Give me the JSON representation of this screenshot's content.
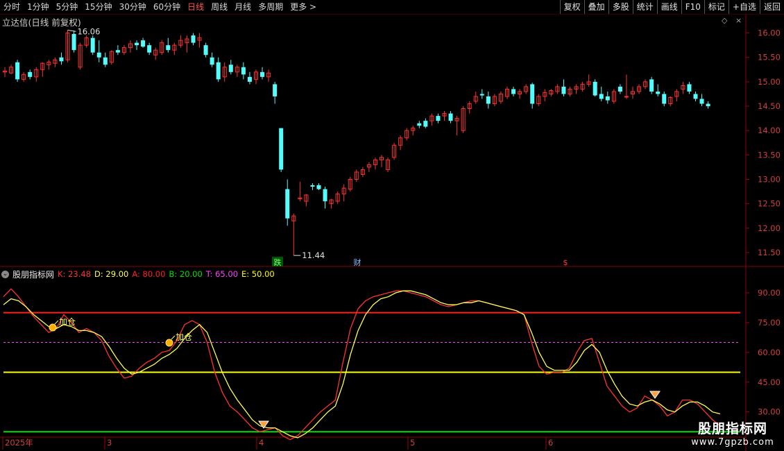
{
  "toolbar": {
    "periods": [
      "分时",
      "1分钟",
      "5分钟",
      "15分钟",
      "30分钟",
      "60分钟",
      "日线",
      "周线",
      "月线",
      "多周期",
      "更多 >"
    ],
    "active_index": 6,
    "right": [
      "复权",
      "叠加",
      "多股",
      "统计",
      "画线",
      "F10",
      "标记",
      "+自选",
      "返回"
    ]
  },
  "main": {
    "title": "立达信(日线 前复权)",
    "high_label": "16.06",
    "low_label": "11.44",
    "markers": [
      "跌",
      "财",
      "$"
    ]
  },
  "indicator": {
    "name": "股朋指标网",
    "K": "K: 23.48",
    "D": "D: 29.00",
    "A": "A: 80.00",
    "B": "B: 20.00",
    "T": "T: 65.00",
    "E": "E: 50.00",
    "signal": "加仓"
  },
  "dates": [
    "2025年",
    "3",
    "4",
    "5",
    "6"
  ],
  "logo": {
    "name": "股朋指标网",
    "url": "www.7gpzb.com"
  },
  "colors": {
    "up": "#ff3232",
    "down": "#54fcfc",
    "K": "#ff3232",
    "D": "#ffff54",
    "A": "#ff2020",
    "B": "#00e000",
    "T": "#ff40ff",
    "E": "#ffff00"
  },
  "chart_data": [
    {
      "type": "candlestick",
      "title": "立达信(日线 前复权)",
      "ylim": [
        11.3,
        16.25
      ],
      "yticks": [
        11.5,
        12.0,
        12.5,
        13.0,
        13.5,
        14.0,
        14.5,
        15.0,
        15.5,
        16.0
      ],
      "ohlc": [
        [
          15.2,
          15.3,
          15.1,
          15.22
        ],
        [
          15.18,
          15.35,
          15.15,
          15.3
        ],
        [
          15.4,
          15.45,
          15.0,
          15.05
        ],
        [
          15.05,
          15.2,
          15.0,
          15.15
        ],
        [
          15.2,
          15.25,
          15.05,
          15.1
        ],
        [
          15.1,
          15.3,
          15.0,
          15.25
        ],
        [
          15.25,
          15.4,
          15.1,
          15.38
        ],
        [
          15.35,
          15.45,
          15.25,
          15.4
        ],
        [
          15.38,
          15.5,
          15.3,
          15.45
        ],
        [
          15.5,
          15.6,
          15.35,
          15.42
        ],
        [
          15.45,
          16.06,
          15.4,
          16.0
        ],
        [
          15.98,
          16.05,
          15.6,
          15.65
        ],
        [
          15.3,
          15.8,
          15.25,
          15.75
        ],
        [
          15.75,
          15.95,
          15.7,
          15.9
        ],
        [
          15.9,
          15.95,
          15.55,
          15.6
        ],
        [
          15.6,
          15.85,
          15.4,
          15.5
        ],
        [
          15.5,
          15.6,
          15.3,
          15.35
        ],
        [
          15.4,
          15.65,
          15.35,
          15.62
        ],
        [
          15.65,
          15.75,
          15.55,
          15.6
        ],
        [
          15.6,
          15.75,
          15.55,
          15.7
        ],
        [
          15.7,
          15.85,
          15.6,
          15.78
        ],
        [
          15.8,
          15.85,
          15.65,
          15.75
        ],
        [
          15.85,
          15.9,
          15.7,
          15.72
        ],
        [
          15.75,
          15.8,
          15.55,
          15.6
        ],
        [
          15.55,
          15.7,
          15.45,
          15.65
        ],
        [
          15.6,
          15.85,
          15.55,
          15.8
        ],
        [
          15.75,
          15.9,
          15.6,
          15.65
        ],
        [
          15.65,
          15.8,
          15.55,
          15.75
        ],
        [
          15.75,
          15.95,
          15.7,
          15.85
        ],
        [
          15.8,
          15.95,
          15.6,
          15.88
        ],
        [
          15.95,
          16.0,
          15.75,
          15.8
        ],
        [
          15.85,
          16.0,
          15.7,
          15.9
        ],
        [
          15.75,
          15.8,
          15.5,
          15.55
        ],
        [
          15.5,
          15.6,
          15.3,
          15.35
        ],
        [
          15.4,
          15.5,
          15.0,
          15.05
        ],
        [
          15.1,
          15.4,
          15.0,
          15.3
        ],
        [
          15.35,
          15.45,
          15.15,
          15.2
        ],
        [
          15.2,
          15.35,
          15.1,
          15.3
        ],
        [
          15.3,
          15.4,
          15.05,
          15.15
        ],
        [
          15.1,
          15.2,
          14.95,
          15.0
        ],
        [
          15.05,
          15.25,
          14.95,
          15.2
        ],
        [
          15.2,
          15.3,
          15.05,
          15.1
        ],
        [
          15.1,
          15.25,
          15.0,
          15.18
        ],
        [
          14.95,
          15.0,
          14.55,
          14.7
        ],
        [
          14.05,
          14.05,
          13.15,
          13.2
        ],
        [
          12.8,
          13.0,
          12.05,
          12.2
        ],
        [
          12.15,
          12.3,
          11.44,
          12.25
        ],
        [
          12.6,
          12.95,
          12.55,
          12.62
        ],
        [
          12.55,
          12.7,
          12.45,
          12.68
        ],
        [
          12.88,
          12.92,
          12.78,
          12.85
        ],
        [
          12.88,
          12.92,
          12.78,
          12.8
        ],
        [
          12.8,
          12.85,
          12.4,
          12.55
        ],
        [
          12.5,
          12.6,
          12.4,
          12.58
        ],
        [
          12.55,
          12.75,
          12.5,
          12.7
        ],
        [
          12.7,
          12.9,
          12.55,
          12.82
        ],
        [
          12.8,
          13.05,
          12.75,
          13.0
        ],
        [
          13.0,
          13.2,
          12.95,
          13.15
        ],
        [
          13.1,
          13.25,
          13.05,
          13.2
        ],
        [
          13.25,
          13.35,
          13.15,
          13.3
        ],
        [
          13.3,
          13.45,
          13.2,
          13.4
        ],
        [
          13.4,
          13.5,
          13.25,
          13.45
        ],
        [
          13.2,
          13.45,
          13.15,
          13.4
        ],
        [
          13.45,
          13.75,
          13.4,
          13.7
        ],
        [
          13.7,
          13.9,
          13.6,
          13.85
        ],
        [
          13.85,
          14.05,
          13.8,
          14.0
        ],
        [
          14.0,
          14.1,
          13.9,
          14.05
        ],
        [
          14.15,
          14.2,
          14.05,
          14.1
        ],
        [
          14.2,
          14.25,
          14.05,
          14.08
        ],
        [
          14.2,
          14.35,
          14.1,
          14.3
        ],
        [
          14.3,
          14.35,
          14.15,
          14.2
        ],
        [
          14.3,
          14.4,
          14.2,
          14.35
        ],
        [
          14.35,
          14.4,
          14.15,
          14.2
        ],
        [
          14.2,
          14.3,
          13.9,
          14.25
        ],
        [
          14.0,
          14.5,
          13.95,
          14.45
        ],
        [
          14.45,
          14.6,
          14.35,
          14.55
        ],
        [
          14.6,
          14.8,
          14.55,
          14.7
        ],
        [
          14.75,
          14.85,
          14.65,
          14.72
        ],
        [
          14.7,
          14.8,
          14.45,
          14.55
        ],
        [
          14.55,
          14.75,
          14.5,
          14.7
        ],
        [
          14.6,
          14.8,
          14.55,
          14.75
        ],
        [
          14.7,
          14.9,
          14.65,
          14.85
        ],
        [
          14.85,
          14.9,
          14.7,
          14.75
        ],
        [
          14.75,
          14.85,
          14.65,
          14.8
        ],
        [
          14.8,
          14.95,
          14.75,
          14.9
        ],
        [
          14.95,
          14.98,
          14.45,
          14.55
        ],
        [
          14.55,
          14.75,
          14.5,
          14.7
        ],
        [
          14.7,
          14.85,
          14.6,
          14.78
        ],
        [
          14.75,
          14.85,
          14.7,
          14.82
        ],
        [
          14.8,
          14.95,
          14.75,
          14.9
        ],
        [
          14.9,
          15.05,
          14.7,
          14.75
        ],
        [
          14.75,
          14.9,
          14.7,
          14.85
        ],
        [
          14.85,
          14.95,
          14.75,
          14.9
        ],
        [
          14.85,
          15.0,
          14.8,
          14.95
        ],
        [
          14.95,
          15.15,
          14.9,
          15.0
        ],
        [
          15.0,
          15.05,
          14.7,
          14.72
        ],
        [
          14.75,
          14.9,
          14.6,
          14.65
        ],
        [
          14.7,
          14.8,
          14.55,
          14.62
        ],
        [
          14.6,
          14.85,
          14.55,
          14.8
        ],
        [
          14.9,
          14.95,
          14.75,
          14.8
        ],
        [
          14.7,
          15.15,
          14.65,
          14.7
        ],
        [
          14.75,
          14.9,
          14.65,
          14.8
        ],
        [
          14.8,
          14.95,
          14.75,
          14.9
        ],
        [
          14.9,
          15.05,
          14.85,
          15.0
        ],
        [
          15.05,
          15.1,
          14.75,
          14.8
        ],
        [
          14.8,
          14.95,
          14.7,
          14.75
        ],
        [
          14.75,
          14.8,
          14.5,
          14.55
        ],
        [
          14.55,
          14.7,
          14.5,
          14.68
        ],
        [
          14.7,
          14.85,
          14.6,
          14.8
        ],
        [
          14.85,
          15.0,
          14.75,
          14.92
        ],
        [
          14.95,
          15.0,
          14.75,
          14.8
        ],
        [
          14.75,
          14.8,
          14.6,
          14.65
        ],
        [
          14.65,
          14.75,
          14.5,
          14.55
        ],
        [
          14.55,
          14.6,
          14.45,
          14.5
        ]
      ]
    },
    {
      "type": "line",
      "title": "股朋指标网",
      "ylim": [
        18,
        97
      ],
      "yticks": [
        30,
        45,
        60,
        75,
        90
      ],
      "hlines": {
        "A": 80,
        "B": 20,
        "T": 65,
        "E": 50
      },
      "series": [
        {
          "name": "K",
          "values": [
            88,
            92,
            88,
            83,
            78,
            74,
            70,
            72,
            79,
            75,
            70,
            72,
            70,
            66,
            58,
            52,
            47,
            48,
            52,
            55,
            57,
            60,
            61,
            66,
            74,
            76,
            74,
            65,
            50,
            40,
            33,
            30,
            26,
            22,
            20,
            21,
            22,
            18,
            16,
            18,
            22,
            26,
            30,
            33,
            36,
            55,
            72,
            82,
            86,
            88,
            89,
            90,
            91,
            91,
            90,
            89,
            88,
            86,
            84,
            83,
            84,
            85,
            86,
            86,
            85,
            84,
            83,
            82,
            81,
            79,
            65,
            53,
            49,
            50,
            50,
            52,
            60,
            66,
            67,
            55,
            43,
            38,
            33,
            30,
            32,
            38,
            36,
            33,
            28,
            30,
            36,
            36,
            34,
            30,
            26,
            23
          ]
        },
        {
          "name": "D",
          "values": [
            84,
            87,
            86,
            83,
            79,
            76,
            73,
            72,
            74,
            73,
            71,
            71,
            70,
            68,
            63,
            57,
            52,
            49,
            50,
            52,
            54,
            57,
            59,
            62,
            67,
            71,
            74,
            70,
            60,
            50,
            42,
            36,
            31,
            26,
            23,
            22,
            22,
            20,
            18,
            17,
            19,
            22,
            26,
            30,
            33,
            44,
            59,
            71,
            79,
            84,
            87,
            88,
            90,
            91,
            91,
            90,
            89,
            87,
            85,
            84,
            84,
            85,
            85,
            86,
            85,
            84,
            83,
            82,
            81,
            79,
            70,
            60,
            53,
            51,
            51,
            51,
            55,
            61,
            64,
            60,
            51,
            44,
            38,
            34,
            33,
            35,
            36,
            34,
            31,
            30,
            33,
            35,
            35,
            33,
            30,
            29
          ]
        }
      ]
    }
  ]
}
